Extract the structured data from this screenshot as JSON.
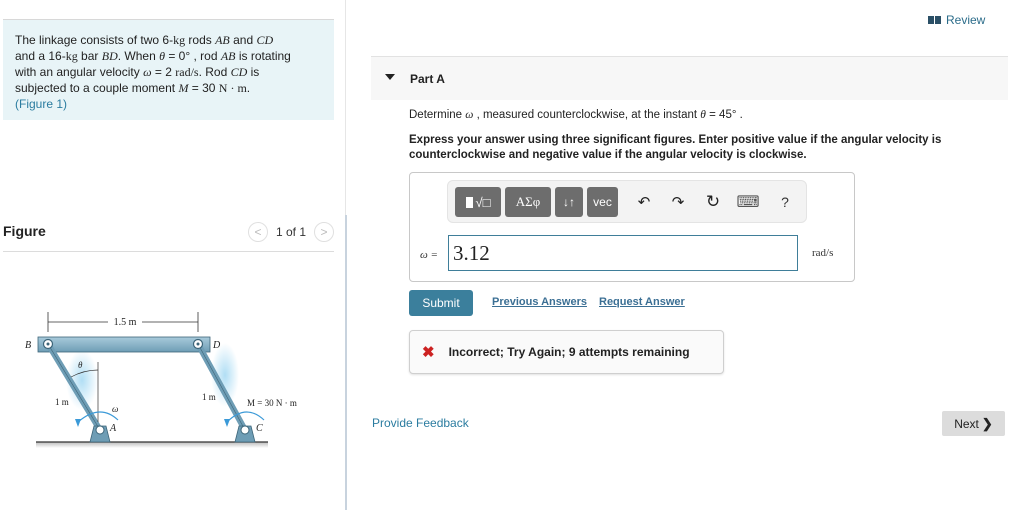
{
  "problem": {
    "text_parts": {
      "p1": "The linkage consists of two 6-",
      "kg1": "kg",
      "p2": " rods ",
      "ab": "AB",
      "p3": " and ",
      "cd": "CD",
      "p4": "and a 16-",
      "kg2": "kg",
      "p5": " bar ",
      "bd": "BD",
      "p6": ". When ",
      "theta": "θ",
      "p7": " = 0° , rod ",
      "ab2": "AB",
      "p8": " is rotating",
      "p9": "with an angular velocity ",
      "omega": "ω",
      "p10": " = 2 ",
      "rads": "rad/s",
      "p11": ". Rod ",
      "cd2": "CD",
      "p12": " is",
      "p13": "subjected to a couple moment ",
      "m": "M",
      "p14": " = 30 ",
      "nm": "N · m",
      "p15": "."
    },
    "figure_link": "(Figure 1)"
  },
  "figure": {
    "title": "Figure",
    "pager_label": "1 of 1",
    "prev_icon": "chevron-left",
    "next_icon": "chevron-right",
    "labels": {
      "span": "1.5 m",
      "b": "B",
      "d": "D",
      "theta": "θ",
      "ab_len": "1 m",
      "cd_len": "1 m",
      "omega": "ω",
      "a": "A",
      "c": "C",
      "moment": "M = 30 N · m"
    }
  },
  "header": {
    "review_label": "Review"
  },
  "part": {
    "title": "Part A",
    "question_parts": {
      "q1": "Determine ",
      "omega": "ω",
      "q2": " , measured counterclockwise, at the instant ",
      "theta": "θ",
      "q3": " = 45°  ."
    },
    "instructions": "Express your answer using three significant figures. Enter positive value if the angular velocity is counterclockwise and negative value if the angular velocity is clockwise."
  },
  "toolbar": {
    "templates_label": "√□",
    "greek_label": "ΑΣφ",
    "arrows_label": "↓↑",
    "vec_label": "vec",
    "undo_icon": "↶",
    "redo_icon": "↷",
    "reset_icon": "↻",
    "keyboard_icon": "⌨",
    "help_label": "?"
  },
  "answer": {
    "variable_label": "ω =",
    "value": "3.12",
    "unit": "rad/s"
  },
  "actions": {
    "submit_label": "Submit",
    "previous_answers_label": "Previous Answers",
    "request_answer_label": "Request Answer"
  },
  "feedback": {
    "icon": "✖",
    "text": "Incorrect; Try Again; 9 attempts remaining"
  },
  "footer": {
    "provide_feedback_label": "Provide Feedback",
    "next_label": "Next",
    "next_chevron": "❯"
  },
  "colors": {
    "accent": "#3b7f9c",
    "link": "#2b7ca0",
    "error": "#cc2222",
    "problem_bg": "#e8f4f7"
  }
}
